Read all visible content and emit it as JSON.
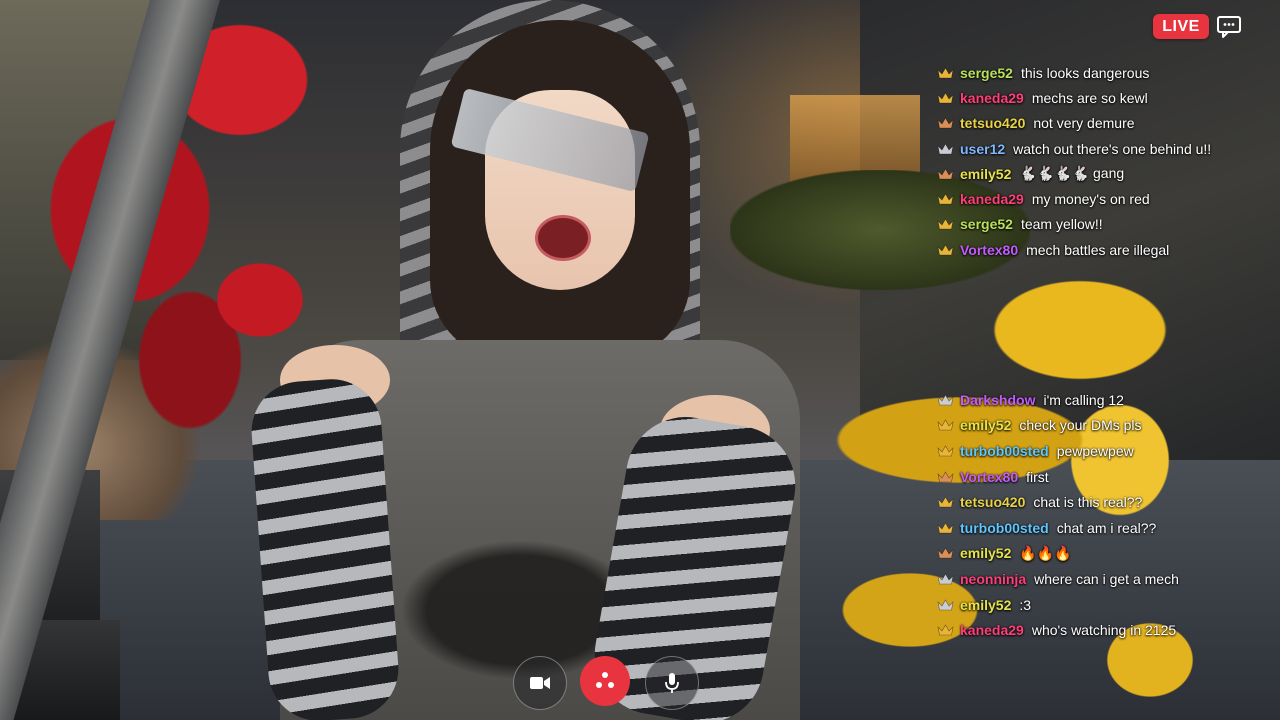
{
  "overlay": {
    "live_label": "LIVE",
    "live_color": "#e8343f",
    "chat_toggle_icon": "chat-bubble-icon"
  },
  "chat": {
    "top_messages": [
      {
        "user": "serge52",
        "text": "this looks dangerous",
        "color": "#b9e05a",
        "crown": "gold"
      },
      {
        "user": "kaneda29",
        "text": "mechs are so kewl",
        "color": "#ff3e7a",
        "crown": "gold"
      },
      {
        "user": "tetsuo420",
        "text": "not very demure",
        "color": "#e8d24a",
        "crown": "bronze"
      },
      {
        "user": "user12",
        "text": "watch out there's one behind u!!",
        "color": "#7fb8ff",
        "crown": "silver"
      },
      {
        "user": "emily52",
        "text": "🐇🐇🐇🐇 gang",
        "color": "#e8e24a",
        "crown": "bronze"
      },
      {
        "user": "kaneda29",
        "text": "my money's on red",
        "color": "#ff3e7a",
        "crown": "gold"
      },
      {
        "user": "serge52",
        "text": "team yellow!!",
        "color": "#b9e05a",
        "crown": "gold"
      },
      {
        "user": "Vortex80",
        "text": "mech battles are illegal",
        "color": "#c35bff",
        "crown": "gold"
      }
    ],
    "bottom_messages": [
      {
        "user": "Darkshdow",
        "text": "i'm calling 12",
        "color": "#c35bff",
        "crown": "silver"
      },
      {
        "user": "emily52",
        "text": "check your DMs pls",
        "color": "#e8e24a",
        "crown": "gold"
      },
      {
        "user": "turbob00sted",
        "text": "pewpewpew",
        "color": "#5ec7ff",
        "crown": "gold"
      },
      {
        "user": "Vortex80",
        "text": "first",
        "color": "#c35bff",
        "crown": "bronze"
      },
      {
        "user": "tetsuo420",
        "text": "chat is this real??",
        "color": "#e8d24a",
        "crown": "gold"
      },
      {
        "user": "turbob00sted",
        "text": "chat am i real??",
        "color": "#5ec7ff",
        "crown": "gold"
      },
      {
        "user": "emily52",
        "text": "🔥🔥🔥",
        "color": "#e8e24a",
        "crown": "bronze"
      },
      {
        "user": "neonninja",
        "text": "where can i get a mech",
        "color": "#ff3e7a",
        "crown": "silver"
      },
      {
        "user": "emily52",
        "text": ":3",
        "color": "#e8e24a",
        "crown": "silver"
      },
      {
        "user": "kaneda29",
        "text": "who's watching in 2125",
        "color": "#ff3e7a",
        "crown": "gold"
      }
    ]
  },
  "controls": {
    "camera_icon": "video-camera-icon",
    "end_icon": "end-call-icon",
    "mic_icon": "microphone-icon",
    "end_color": "#e8343f"
  },
  "crown_colors": {
    "gold": "#e8b53a",
    "silver": "#c9ccd3",
    "bronze": "#d98f55"
  }
}
